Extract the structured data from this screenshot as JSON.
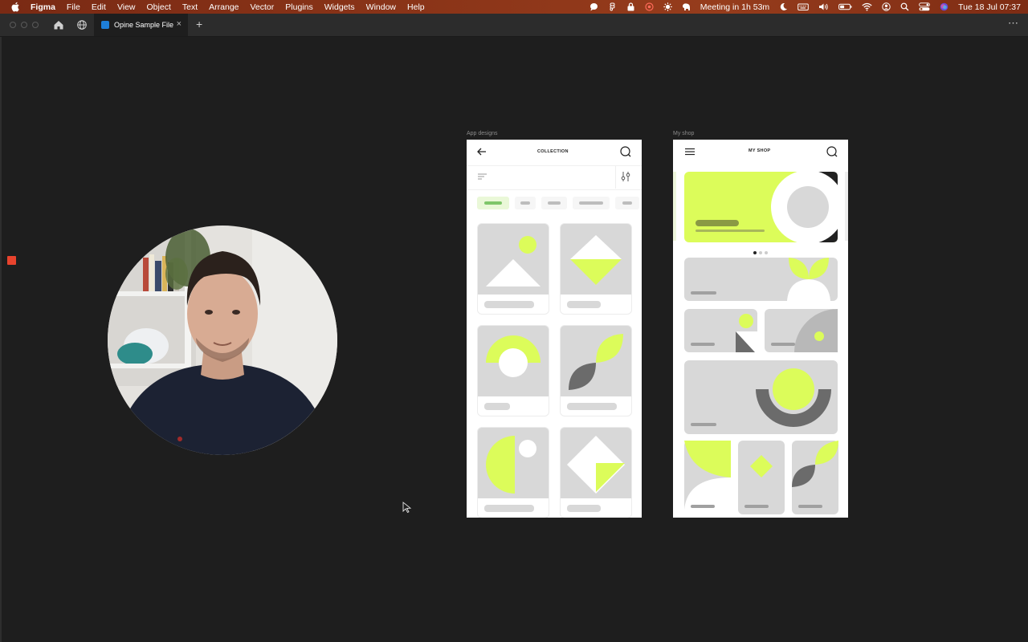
{
  "menubar": {
    "app_name": "Figma",
    "menus": [
      "File",
      "Edit",
      "View",
      "Object",
      "Text",
      "Arrange",
      "Vector",
      "Plugins",
      "Widgets",
      "Window",
      "Help"
    ],
    "meeting_text": "Meeting in 1h 53m",
    "date_time": "Tue 18 Jul  07:37"
  },
  "tabbar": {
    "file_tab_label": "Opine Sample File",
    "close_symbol": "×",
    "add_symbol": "+",
    "more_symbol": "⋯"
  },
  "canvas": {
    "frames": [
      {
        "label": "App designs",
        "title": "COLLECTION"
      },
      {
        "label": "My shop",
        "title": "MY SHOP"
      }
    ],
    "colors": {
      "accent": "#dcfc5a",
      "placeholder": "#d8d8d8",
      "dark": "#222222",
      "canvas": "#1e1e1e"
    }
  }
}
